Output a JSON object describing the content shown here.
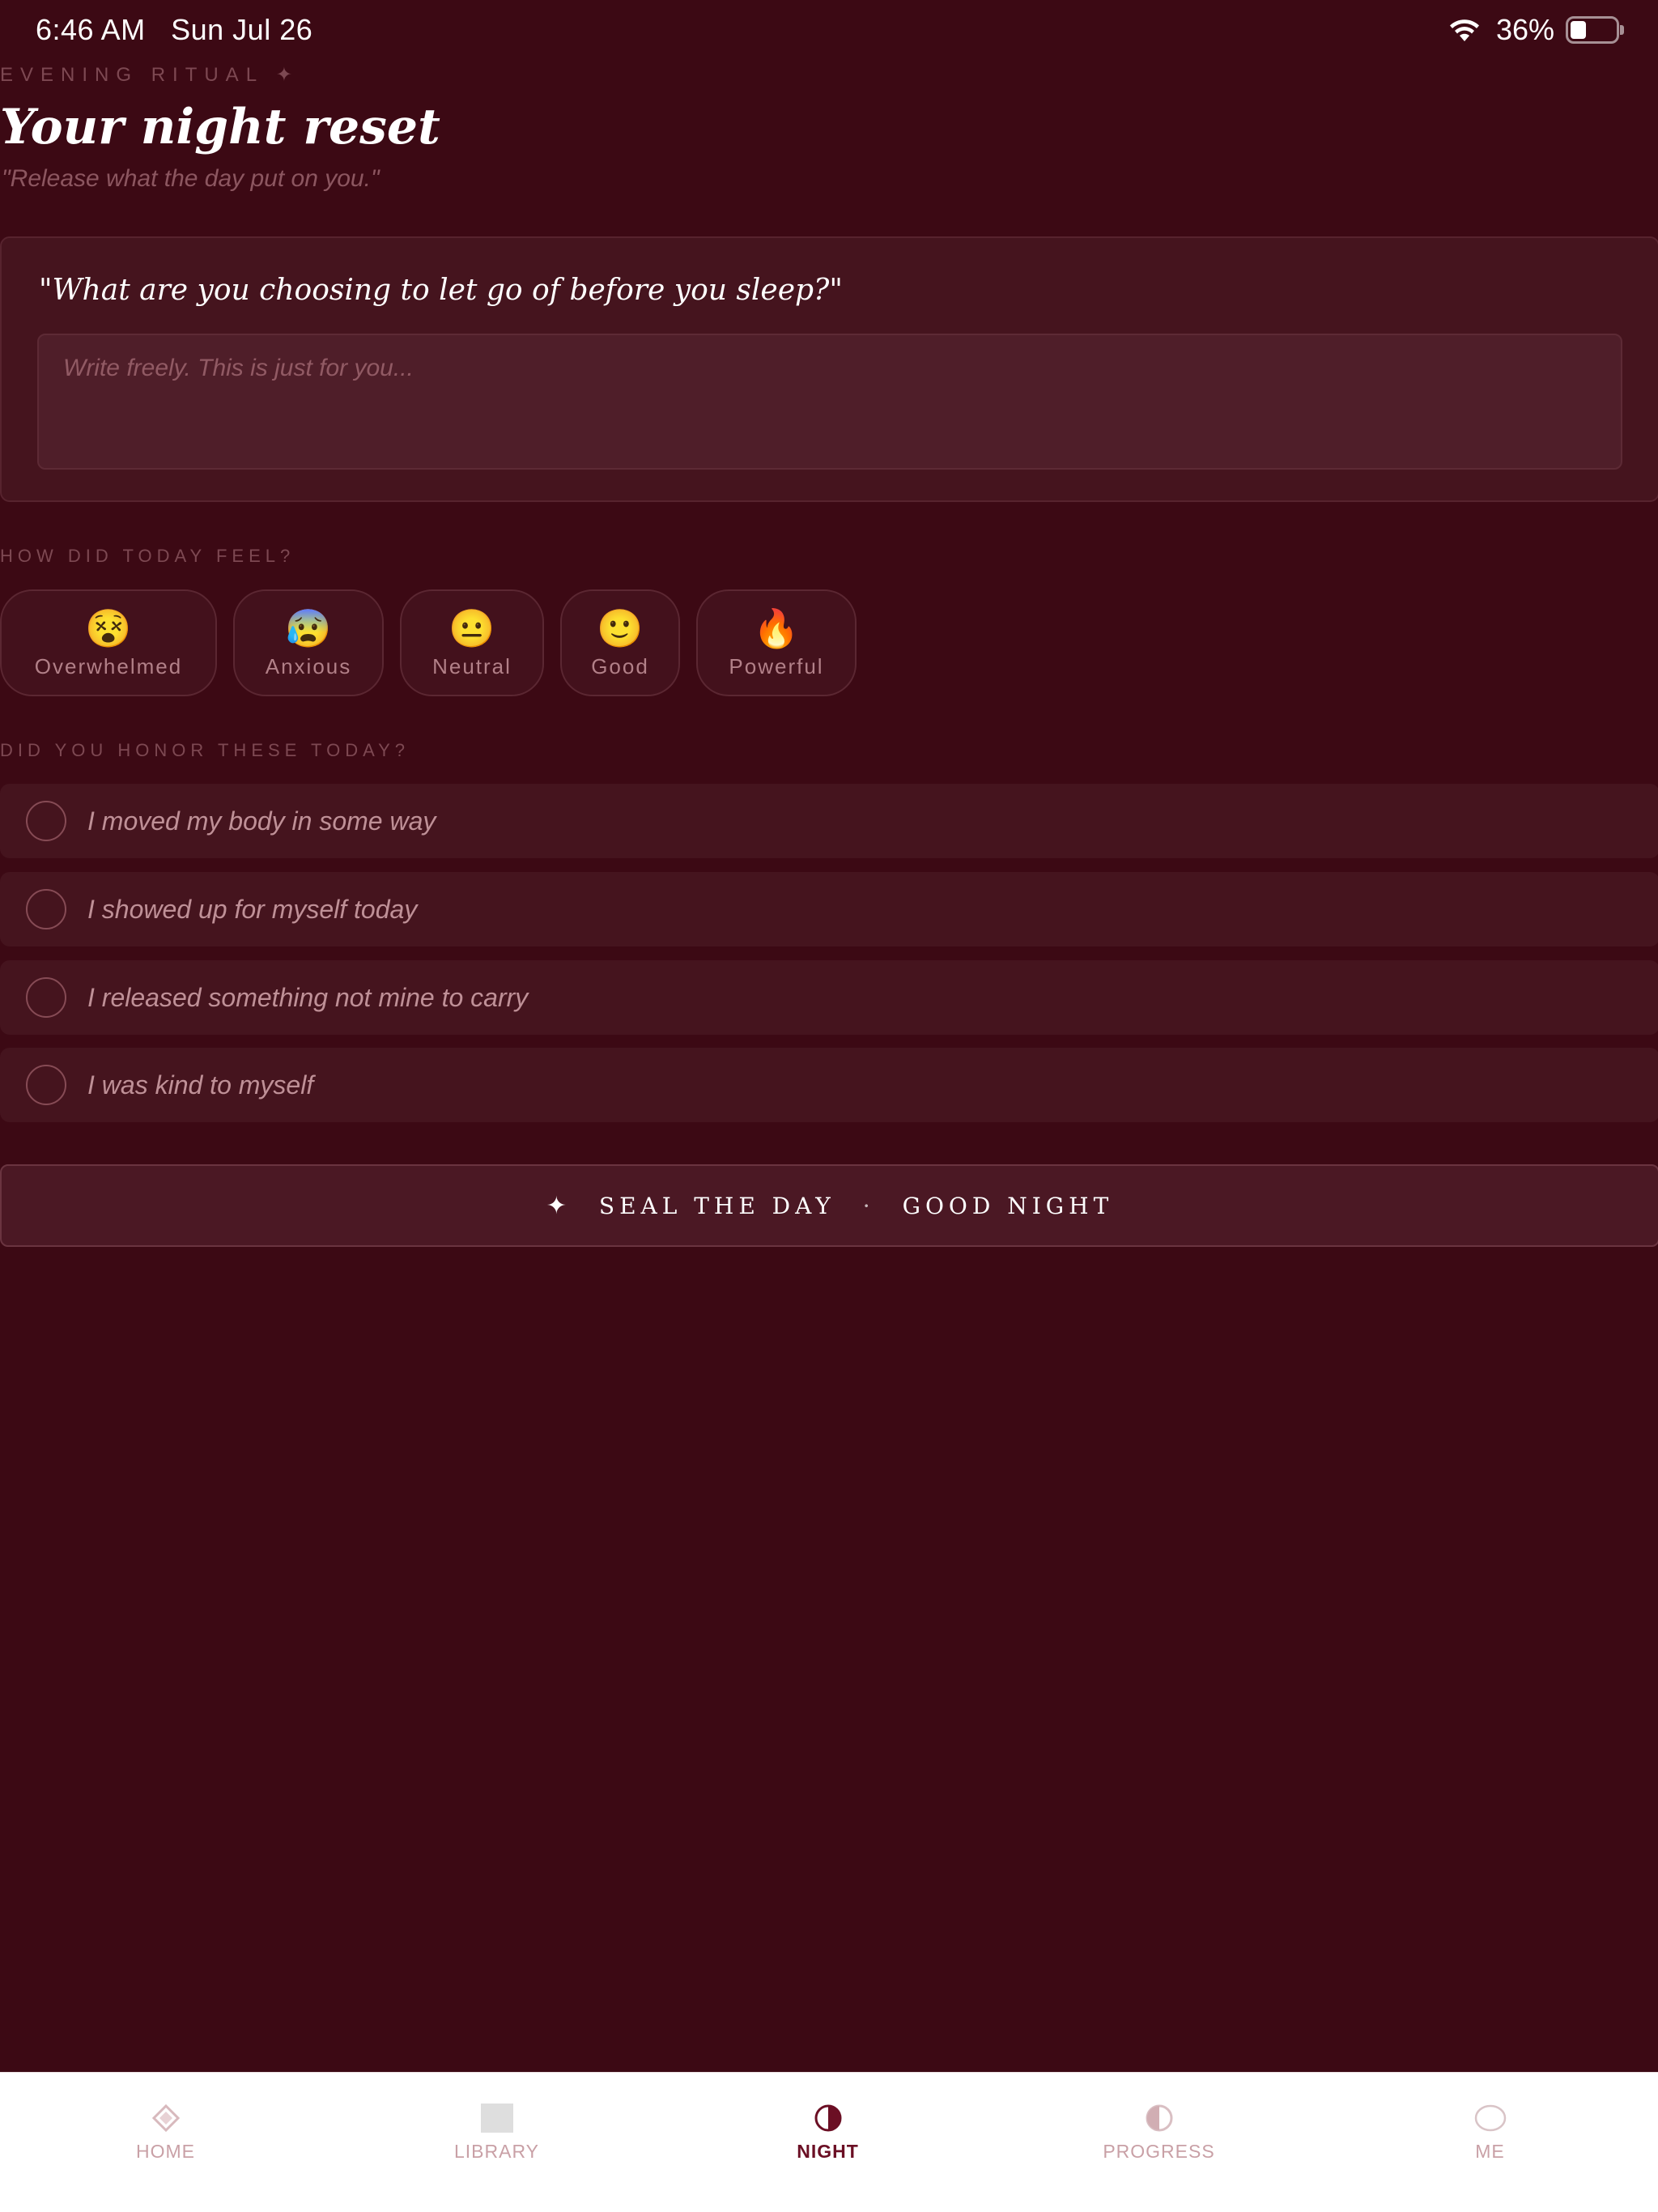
{
  "status_bar": {
    "time": "6:46 AM",
    "date": "Sun Jul 26",
    "battery": "36%",
    "battery_level": 0.36
  },
  "header": {
    "eyebrow": "EVENING RITUAL ✦",
    "title": "Your night reset",
    "subtitle": "\"Release what the day put on you.\""
  },
  "journal": {
    "prompt": "\"What are you choosing to let go of before you sleep?\"",
    "placeholder": "Write freely. This is just for you...",
    "value": ""
  },
  "moods": {
    "label": "HOW DID TODAY FEEL?",
    "items": [
      {
        "emoji": "😵",
        "label": "Overwhelmed"
      },
      {
        "emoji": "😰",
        "label": "Anxious"
      },
      {
        "emoji": "😐",
        "label": "Neutral"
      },
      {
        "emoji": "🙂",
        "label": "Good"
      },
      {
        "emoji": "🔥",
        "label": "Powerful"
      }
    ]
  },
  "intentions": {
    "label": "DID YOU HONOR THESE TODAY?",
    "items": [
      {
        "text": "I moved my body in some way",
        "checked": false
      },
      {
        "text": "I showed up for myself today",
        "checked": false
      },
      {
        "text": "I released something not mine to carry",
        "checked": false
      },
      {
        "text": "I was kind to myself",
        "checked": false
      }
    ]
  },
  "seal_button": {
    "icon": "✦",
    "part1": "SEAL THE DAY",
    "separator": "·",
    "part2": "GOOD NIGHT"
  },
  "tab_bar": {
    "active": "NIGHT",
    "items": [
      {
        "label": "HOME",
        "icon": "diamond-icon"
      },
      {
        "label": "LIBRARY",
        "icon": "square-icon"
      },
      {
        "label": "NIGHT",
        "icon": "half-moon-icon"
      },
      {
        "label": "PROGRESS",
        "icon": "half-circle-icon"
      },
      {
        "label": "ME",
        "icon": "circle-icon"
      }
    ]
  },
  "colors": {
    "background": "#3c0914",
    "card": "#45141e",
    "accent": "#6b0f24",
    "muted_text": "#c9a0a6"
  }
}
